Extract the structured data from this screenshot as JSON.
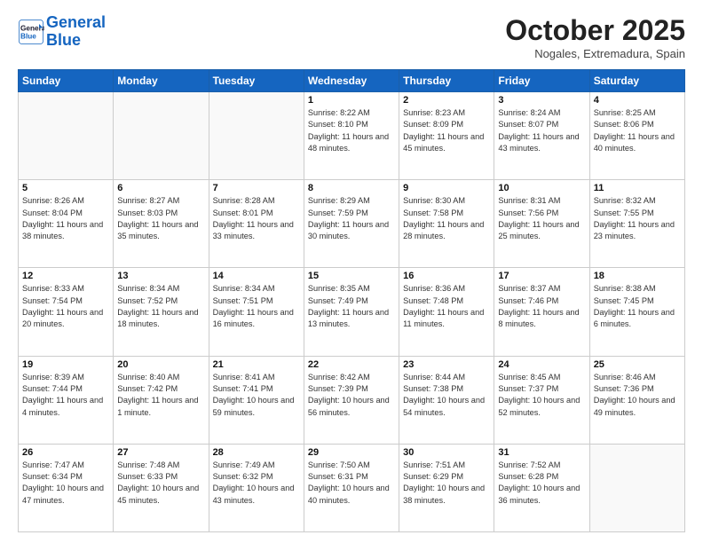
{
  "header": {
    "logo_line1": "General",
    "logo_line2": "Blue",
    "month_title": "October 2025",
    "location": "Nogales, Extremadura, Spain"
  },
  "weekdays": [
    "Sunday",
    "Monday",
    "Tuesday",
    "Wednesday",
    "Thursday",
    "Friday",
    "Saturday"
  ],
  "weeks": [
    [
      {
        "day": "",
        "info": ""
      },
      {
        "day": "",
        "info": ""
      },
      {
        "day": "",
        "info": ""
      },
      {
        "day": "1",
        "info": "Sunrise: 8:22 AM\nSunset: 8:10 PM\nDaylight: 11 hours\nand 48 minutes."
      },
      {
        "day": "2",
        "info": "Sunrise: 8:23 AM\nSunset: 8:09 PM\nDaylight: 11 hours\nand 45 minutes."
      },
      {
        "day": "3",
        "info": "Sunrise: 8:24 AM\nSunset: 8:07 PM\nDaylight: 11 hours\nand 43 minutes."
      },
      {
        "day": "4",
        "info": "Sunrise: 8:25 AM\nSunset: 8:06 PM\nDaylight: 11 hours\nand 40 minutes."
      }
    ],
    [
      {
        "day": "5",
        "info": "Sunrise: 8:26 AM\nSunset: 8:04 PM\nDaylight: 11 hours\nand 38 minutes."
      },
      {
        "day": "6",
        "info": "Sunrise: 8:27 AM\nSunset: 8:03 PM\nDaylight: 11 hours\nand 35 minutes."
      },
      {
        "day": "7",
        "info": "Sunrise: 8:28 AM\nSunset: 8:01 PM\nDaylight: 11 hours\nand 33 minutes."
      },
      {
        "day": "8",
        "info": "Sunrise: 8:29 AM\nSunset: 7:59 PM\nDaylight: 11 hours\nand 30 minutes."
      },
      {
        "day": "9",
        "info": "Sunrise: 8:30 AM\nSunset: 7:58 PM\nDaylight: 11 hours\nand 28 minutes."
      },
      {
        "day": "10",
        "info": "Sunrise: 8:31 AM\nSunset: 7:56 PM\nDaylight: 11 hours\nand 25 minutes."
      },
      {
        "day": "11",
        "info": "Sunrise: 8:32 AM\nSunset: 7:55 PM\nDaylight: 11 hours\nand 23 minutes."
      }
    ],
    [
      {
        "day": "12",
        "info": "Sunrise: 8:33 AM\nSunset: 7:54 PM\nDaylight: 11 hours\nand 20 minutes."
      },
      {
        "day": "13",
        "info": "Sunrise: 8:34 AM\nSunset: 7:52 PM\nDaylight: 11 hours\nand 18 minutes."
      },
      {
        "day": "14",
        "info": "Sunrise: 8:34 AM\nSunset: 7:51 PM\nDaylight: 11 hours\nand 16 minutes."
      },
      {
        "day": "15",
        "info": "Sunrise: 8:35 AM\nSunset: 7:49 PM\nDaylight: 11 hours\nand 13 minutes."
      },
      {
        "day": "16",
        "info": "Sunrise: 8:36 AM\nSunset: 7:48 PM\nDaylight: 11 hours\nand 11 minutes."
      },
      {
        "day": "17",
        "info": "Sunrise: 8:37 AM\nSunset: 7:46 PM\nDaylight: 11 hours\nand 8 minutes."
      },
      {
        "day": "18",
        "info": "Sunrise: 8:38 AM\nSunset: 7:45 PM\nDaylight: 11 hours\nand 6 minutes."
      }
    ],
    [
      {
        "day": "19",
        "info": "Sunrise: 8:39 AM\nSunset: 7:44 PM\nDaylight: 11 hours\nand 4 minutes."
      },
      {
        "day": "20",
        "info": "Sunrise: 8:40 AM\nSunset: 7:42 PM\nDaylight: 11 hours\nand 1 minute."
      },
      {
        "day": "21",
        "info": "Sunrise: 8:41 AM\nSunset: 7:41 PM\nDaylight: 10 hours\nand 59 minutes."
      },
      {
        "day": "22",
        "info": "Sunrise: 8:42 AM\nSunset: 7:39 PM\nDaylight: 10 hours\nand 56 minutes."
      },
      {
        "day": "23",
        "info": "Sunrise: 8:44 AM\nSunset: 7:38 PM\nDaylight: 10 hours\nand 54 minutes."
      },
      {
        "day": "24",
        "info": "Sunrise: 8:45 AM\nSunset: 7:37 PM\nDaylight: 10 hours\nand 52 minutes."
      },
      {
        "day": "25",
        "info": "Sunrise: 8:46 AM\nSunset: 7:36 PM\nDaylight: 10 hours\nand 49 minutes."
      }
    ],
    [
      {
        "day": "26",
        "info": "Sunrise: 7:47 AM\nSunset: 6:34 PM\nDaylight: 10 hours\nand 47 minutes."
      },
      {
        "day": "27",
        "info": "Sunrise: 7:48 AM\nSunset: 6:33 PM\nDaylight: 10 hours\nand 45 minutes."
      },
      {
        "day": "28",
        "info": "Sunrise: 7:49 AM\nSunset: 6:32 PM\nDaylight: 10 hours\nand 43 minutes."
      },
      {
        "day": "29",
        "info": "Sunrise: 7:50 AM\nSunset: 6:31 PM\nDaylight: 10 hours\nand 40 minutes."
      },
      {
        "day": "30",
        "info": "Sunrise: 7:51 AM\nSunset: 6:29 PM\nDaylight: 10 hours\nand 38 minutes."
      },
      {
        "day": "31",
        "info": "Sunrise: 7:52 AM\nSunset: 6:28 PM\nDaylight: 10 hours\nand 36 minutes."
      },
      {
        "day": "",
        "info": ""
      }
    ]
  ]
}
